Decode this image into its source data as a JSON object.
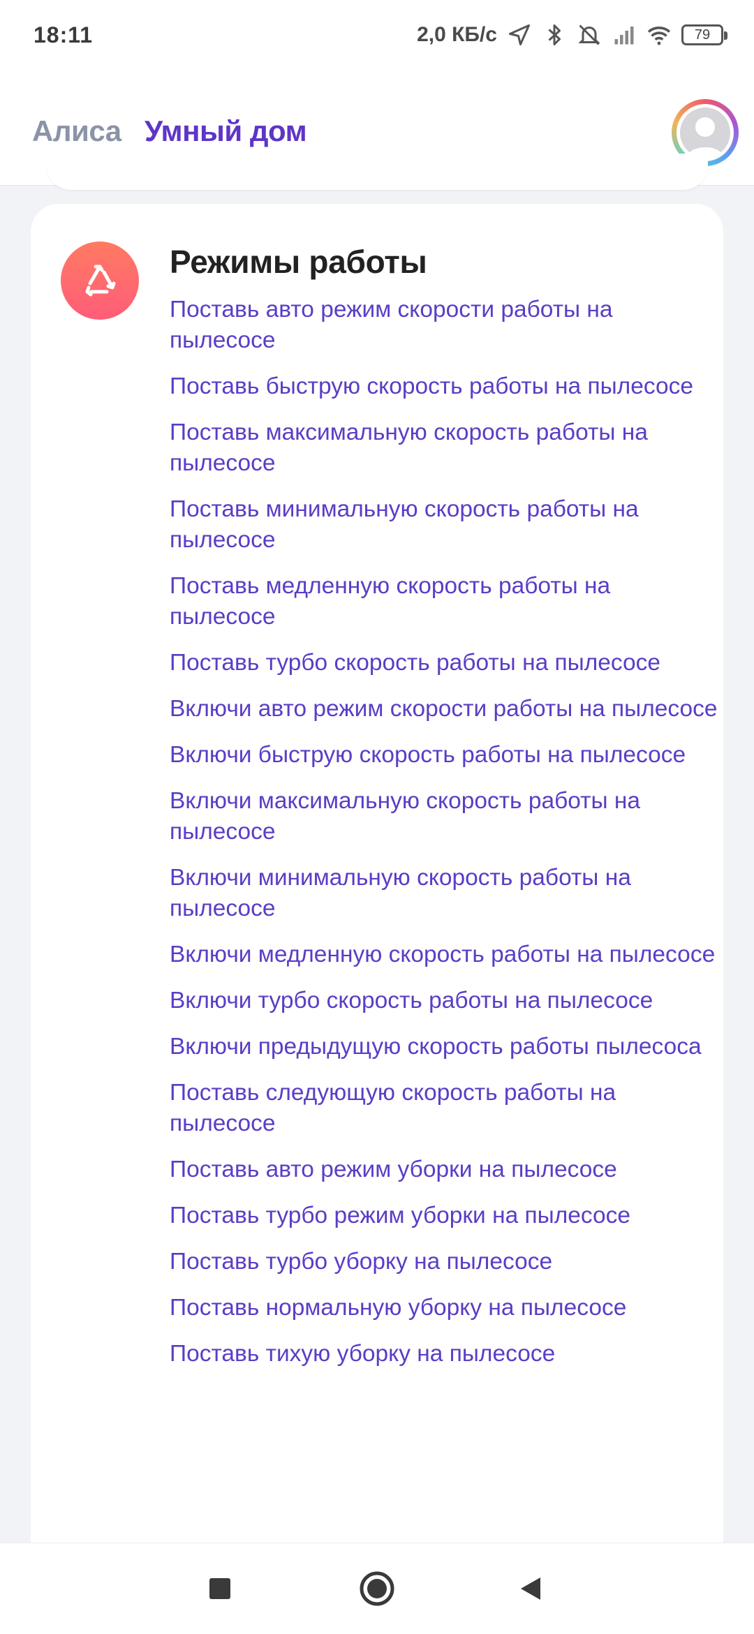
{
  "status_bar": {
    "time": "18:11",
    "speed": "2,0 КБ/с",
    "battery": "79",
    "icons": [
      "location-icon",
      "bluetooth-icon",
      "mute-alarm-icon",
      "signal-icon",
      "wifi-icon",
      "battery-icon"
    ]
  },
  "tabs": {
    "alice": "Алиса",
    "smart_home": "Умный дом",
    "active": "smart_home",
    "accent_color": "#5e35c6"
  },
  "card": {
    "icon": "recycle-triangle-icon",
    "icon_color": "#ff6a6e",
    "title": "Режимы работы",
    "commands": [
      "Поставь авто режим скорости работы на пылесосе",
      "Поставь быструю скорость работы на пылесосе",
      "Поставь максимальную скорость работы на пылесосе",
      "Поставь минимальную скорость работы на пылесосе",
      "Поставь медленную скорость работы на пылесосе",
      "Поставь турбо скорость работы на пылесосе",
      "Включи авто режим скорости работы на пылесосе",
      "Включи быструю скорость работы на пылесосе",
      "Включи максимальную скорость работы на пылесосе",
      "Включи минимальную скорость работы на пылесосе",
      "Включи медленную скорость работы на пылесосе",
      "Включи турбо скорость работы на пылесосе",
      "Включи предыдущую скорость работы пылесоса",
      "Поставь следующую скорость работы на пылесосе",
      "Поставь авто режим уборки на пылесосе",
      "Поставь турбо режим уборки на пылесосе",
      "Поставь турбо уборку на пылесосе",
      "Поставь нормальную уборку на пылесосе",
      "Поставь тихую уборку на пылесосе"
    ]
  },
  "nav": {
    "buttons": [
      "recent-apps-icon",
      "home-icon",
      "back-icon"
    ]
  }
}
